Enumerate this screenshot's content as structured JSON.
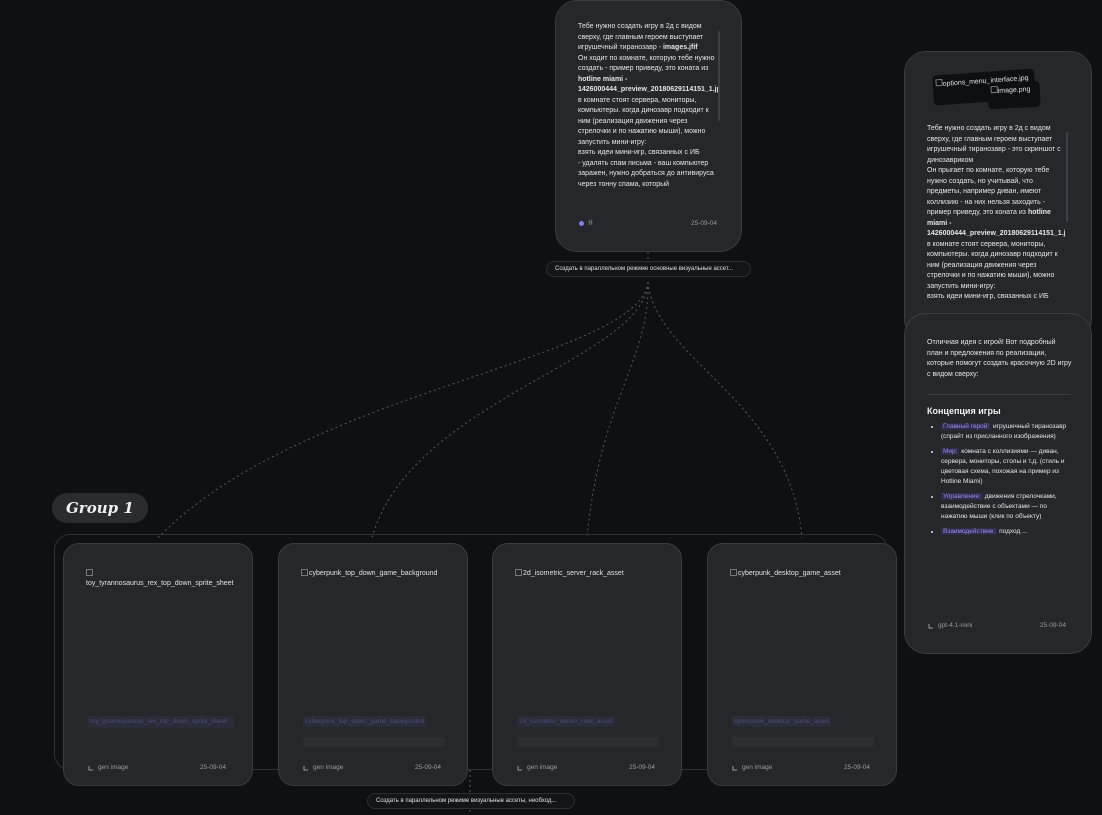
{
  "prompt_node": {
    "text_html": "Тебе нужно создать игру в 2д с видом сверху, где главным героем выступает игрушечный тиранозавр - <b>images.jfif</b>\nОн ходит по комнате, которую тебе нужно создать - пример приведу, это коната из <b>hotline miami - 1426000444_preview_20180629114151_1.jpg</b>\nв комнате стоят сервера, мониторы, компьютеры. когда динозавр подходит к ним (реализация движения через стрелочки и по нажатию мыши), можно запустить мини-игру:\nвзять идеи мини-игр, связанных с ИБ\n- удалять спам письма - ваш компьютер заражен, нужно добраться до антивируса через тонну спама, который",
    "footer_label": "Я",
    "date": "25-09-04"
  },
  "pill_top": "Создать в параллельном режиме основные визуальные ассет...",
  "pill_bottom": "Создать в параллельном режиме визуальные ассеты, необход...",
  "right_prompt_node": {
    "image_names": [
      "options_menu_interface.jpg",
      "image.png"
    ],
    "text_html": "Тебе нужно создать игру в 2д с видом сверху, где главным героем выступает игрушечный тиранозавр - это скриншот с динозавриком\nОн прыгает по комнате, которую тебе нужно создать, но учитывай, что предметы, например диван, имеют коллизию - на них нельзя заходить - пример приведу, это коната из <b>hotline miami - 1426000444_preview_20180629114151_1.jpg</b>\nв комнате стоят сервера, мониторы, компьютеры. когда динозавр подходит к ним (реализация движения через стрелочки и по нажатию мыши), можно запустить мини-игру:\nвзять идеи мини-игр, связанных с ИБ"
  },
  "response_node": {
    "intro": "Отличная идея с игрой! Вот подробный план и предложения по реализации, которые помогут создать красочную 2D игру с видом сверху:",
    "heading": "Концепция игры",
    "bullets": [
      {
        "label": "Главный герой:",
        "text": " игрушечный тиранозавр (спрайт из присланного изображения)"
      },
      {
        "label": "Мир:",
        "text": " комната с коллизиями — диван, сервера, мониторы, столы и т.д. (стиль и цветовая схема, похожая на пример из Hotline Miami)"
      },
      {
        "label": "Управление:",
        "text": " движения стрелочками, взаимодействие с объектами — по нажатию мыши (клик по объекту)"
      },
      {
        "label": "Взаимодействие:",
        "text": " подход ..."
      }
    ],
    "model": "gpt-4.1-mini",
    "date": "25-09-04"
  },
  "group": {
    "label": "Group 1"
  },
  "cards": [
    {
      "img_alt": "toy_tyrannosaurus_rex_top_down_sprite_sheet",
      "title": "toy_tyrannosaurus_rex_top_down_sprite_sheet",
      "footer": "gen image",
      "date": "25-09-04"
    },
    {
      "img_alt": "cyberpunk_top_down_game_background",
      "title": "cyberpunk_top_down_game_background",
      "footer": "gen image",
      "date": "25-09-04"
    },
    {
      "img_alt": "2d_isometric_server_rack_asset",
      "title": "2d_isometric_server_rack_asset",
      "footer": "gen image",
      "date": "25-09-04"
    },
    {
      "img_alt": "cyberpunk_desktop_game_asset",
      "title": "cyberpunk_desktop_game_asset",
      "footer": "gen image",
      "date": "25-09-04"
    }
  ],
  "colors": {
    "background": "#0f1012",
    "node": "#25272a",
    "accent": "#9b8ff0"
  }
}
